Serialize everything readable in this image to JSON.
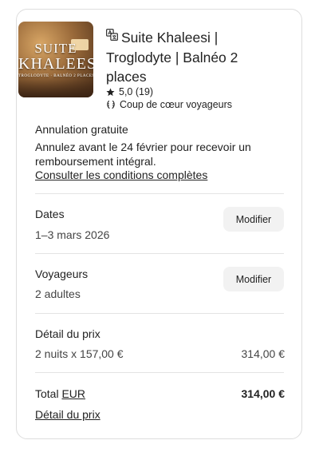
{
  "listing": {
    "image_text_1": "SUITE",
    "image_text_2": "KHALEESI",
    "image_text_3": "TROGLODYTE · BALNÉO 2 PLACES",
    "title": "Suite Khaleesi | Troglodyte | Balnéo 2 places",
    "rating": "5,0 (19)",
    "favorite_label": "Coup de cœur voyageurs",
    "lang_icon": "translate-icon",
    "star_icon": "star-icon",
    "laurel_icon": "laurel-icon"
  },
  "cancellation": {
    "title": "Annulation gratuite",
    "text": "Annulez avant le 24 février pour recevoir un remboursement intégral.",
    "link": "Consulter les conditions complètes"
  },
  "dates": {
    "title": "Dates",
    "value": "1–3 mars 2026",
    "button": "Modifier"
  },
  "guests": {
    "title": "Voyageurs",
    "value": "2 adultes",
    "button": "Modifier"
  },
  "price": {
    "title": "Détail du prix",
    "line_label": "2 nuits x 157,00 €",
    "line_amount": "314,00 €"
  },
  "total": {
    "label": "Total",
    "currency": "EUR",
    "amount": "314,00 €",
    "detail_link": "Détail du prix"
  }
}
